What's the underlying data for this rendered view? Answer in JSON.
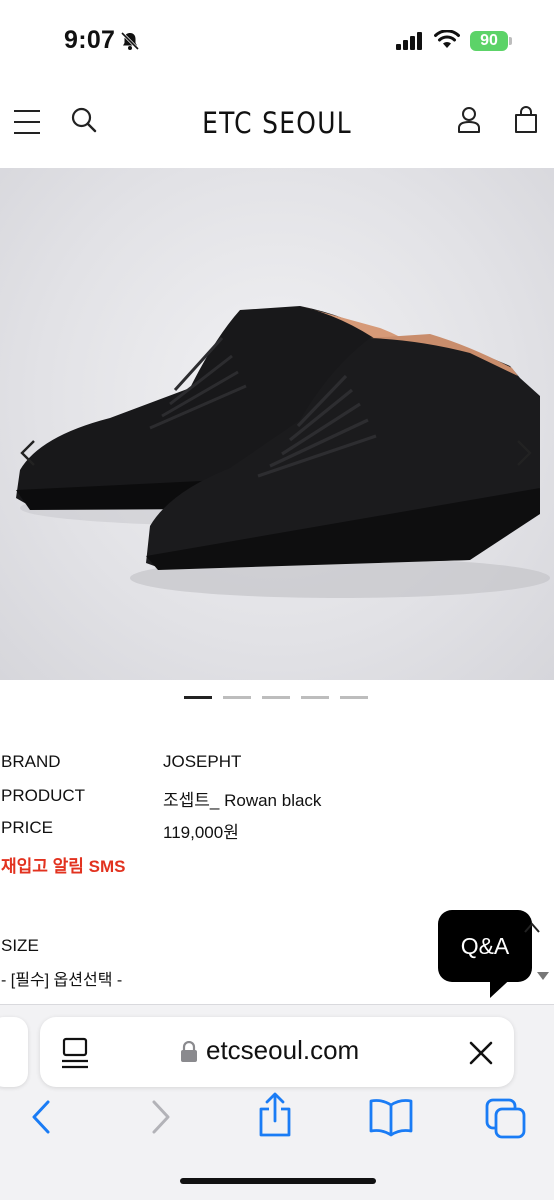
{
  "status_bar": {
    "time": "9:07",
    "battery": "90",
    "icons": [
      "bell-slash-icon",
      "signal-icon",
      "wifi-icon",
      "battery-icon"
    ]
  },
  "header": {
    "brand": "ETC SEOUL",
    "icons": [
      "menu-icon",
      "search-icon",
      "user-icon",
      "shopping-bag-icon"
    ]
  },
  "carousel": {
    "image": "black-leather-sneakers",
    "slide_count": 5,
    "active_slide": 1
  },
  "product": {
    "rows": [
      {
        "label": "BRAND",
        "value": "JOSEPHT"
      },
      {
        "label": "PRODUCT",
        "value": "조셉트_ Rowan black"
      },
      {
        "label": "PRICE",
        "value": "119,000원"
      }
    ],
    "restock_sms": "재입고 알림 SMS"
  },
  "options": {
    "size_label": "SIZE",
    "size_placeholder": "- [필수] 옵션선택 -"
  },
  "qa_button": "Q&A",
  "browser": {
    "url": "etcseoul.com",
    "toolbar": [
      "back-icon",
      "forward-icon",
      "share-icon",
      "bookmarks-icon",
      "tabs-icon"
    ]
  },
  "colors": {
    "accent_red": "#e2321f",
    "battery_green": "#5cd368",
    "browser_blue": "#1a7cf5"
  }
}
